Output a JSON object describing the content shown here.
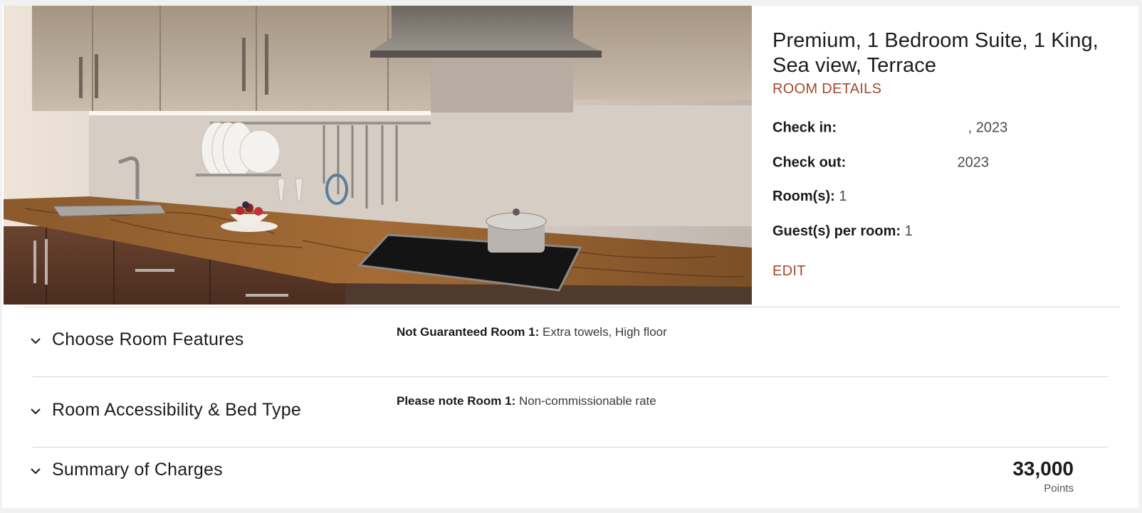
{
  "room": {
    "title": "Premium, 1 Bedroom Suite, 1 King, Sea view, Terrace",
    "details_label": "ROOM DETAILS",
    "check_in_label": "Check in:",
    "check_in_value": ", 2023",
    "check_out_label": "Check out:",
    "check_out_value": "2023",
    "rooms_label": "Room(s):",
    "rooms_value": "1",
    "guests_label": "Guest(s) per room:",
    "guests_value": "1",
    "edit_label": "EDIT"
  },
  "sections": [
    {
      "title": "Choose Room Features",
      "note_label": "Not Guaranteed Room 1:",
      "note_value": "Extra towels, High floor"
    },
    {
      "title": "Room Accessibility & Bed Type",
      "note_label": "Please note Room 1:",
      "note_value": "Non-commissionable rate"
    },
    {
      "title": "Summary of Charges",
      "total_value": "33,000",
      "total_unit": "Points"
    }
  ],
  "icons": {
    "chevron": "chevron-down-icon"
  },
  "colors": {
    "accent": "#a14a2b",
    "text": "#1c1c1c",
    "divider": "#d8d8d8"
  }
}
